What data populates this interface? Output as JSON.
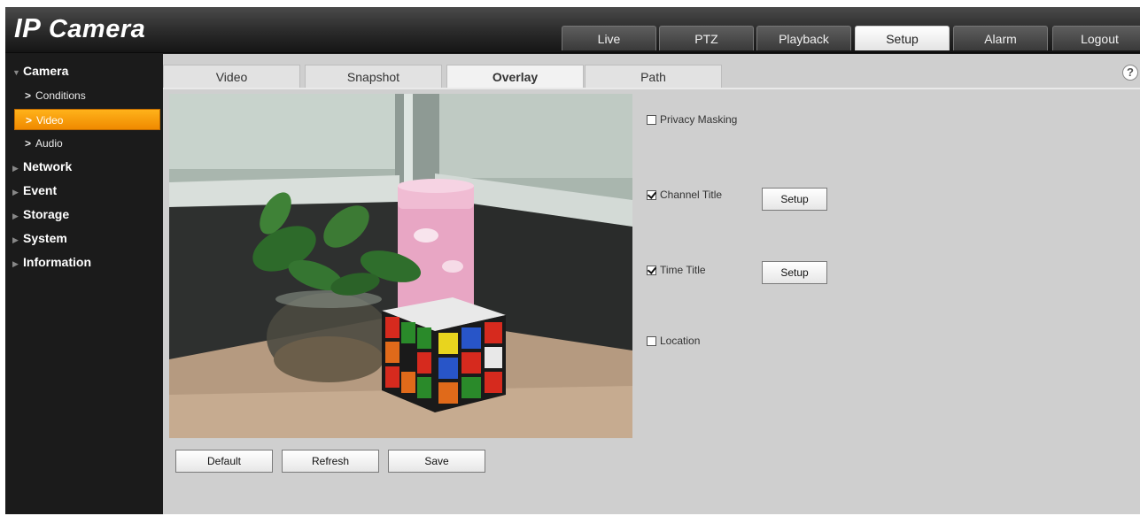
{
  "app": {
    "logo_ip": "IP",
    "logo_rest": "Camera"
  },
  "topnav": [
    {
      "label": "Live"
    },
    {
      "label": "PTZ"
    },
    {
      "label": "Playback"
    },
    {
      "label": "Setup",
      "active": true
    },
    {
      "label": "Alarm"
    },
    {
      "label": "Logout"
    }
  ],
  "sidebar": {
    "groups": [
      {
        "label": "Camera",
        "expanded": true,
        "items": [
          {
            "label": "Conditions"
          },
          {
            "label": "Video",
            "active": true
          },
          {
            "label": "Audio"
          }
        ]
      },
      {
        "label": "Network"
      },
      {
        "label": "Event"
      },
      {
        "label": "Storage"
      },
      {
        "label": "System"
      },
      {
        "label": "Information"
      }
    ]
  },
  "tabs": [
    {
      "label": "Video"
    },
    {
      "label": "Snapshot"
    },
    {
      "label": "Overlay",
      "active": true
    },
    {
      "label": "Path"
    }
  ],
  "help_icon": "?",
  "overlay": {
    "privacy_masking": {
      "label": "Privacy Masking",
      "checked": false
    },
    "channel_title": {
      "label": "Channel Title",
      "checked": true,
      "setup_label": "Setup"
    },
    "time_title": {
      "label": "Time Title",
      "checked": true,
      "setup_label": "Setup"
    },
    "location": {
      "label": "Location",
      "checked": false
    }
  },
  "buttons": {
    "default_label": "Default",
    "refresh_label": "Refresh",
    "save_label": "Save"
  },
  "colors": {
    "active_menu": "#f59a00",
    "header_bg": "#2a2a2a",
    "content_bg": "#cfcfcf"
  }
}
